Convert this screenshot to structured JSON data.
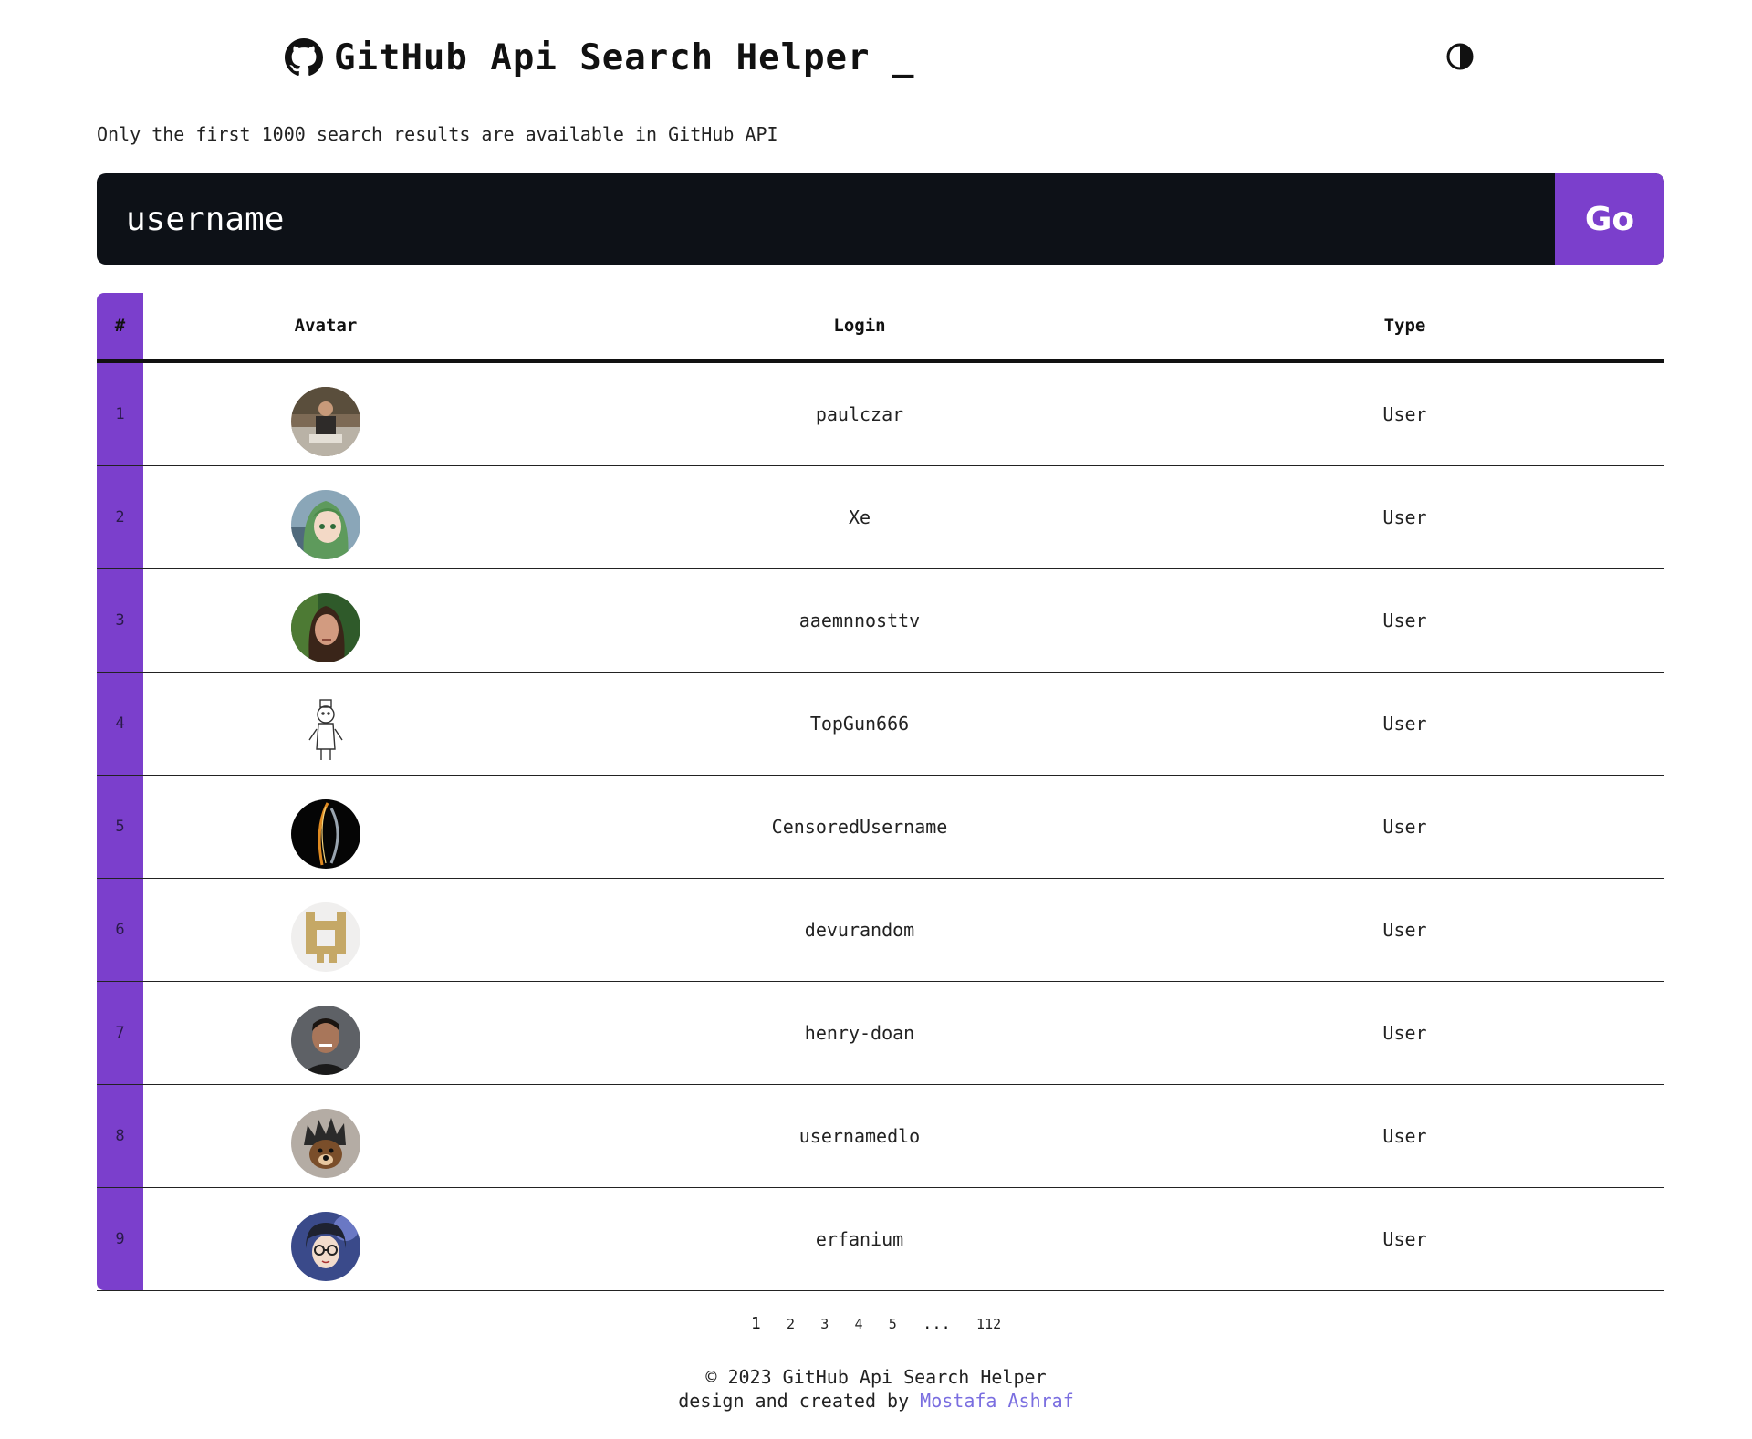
{
  "header": {
    "title": "GitHub Api Search Helper _",
    "logo_icon": "github-icon",
    "theme_toggle_icon": "contrast-icon"
  },
  "note": "Only the first 1000 search results are available in GitHub API",
  "search": {
    "value": "username",
    "button_label": "Go"
  },
  "colors": {
    "accent": "#7b3fcc",
    "search_bg": "#0d1117",
    "link": "#7a6ee0"
  },
  "table": {
    "headers": {
      "index": "#",
      "avatar": "Avatar",
      "login": "Login",
      "type": "Type"
    },
    "rows": [
      {
        "index": "1",
        "login": "paulczar",
        "type": "User",
        "avatar": "photo-man-seated"
      },
      {
        "index": "2",
        "login": "Xe",
        "type": "User",
        "avatar": "anime-green-hair"
      },
      {
        "index": "3",
        "login": "aaemnnosttv",
        "type": "User",
        "avatar": "photo-man-long-hair"
      },
      {
        "index": "4",
        "login": "TopGun666",
        "type": "User",
        "avatar": "sketch-figure"
      },
      {
        "index": "5",
        "login": "CensoredUsername",
        "type": "User",
        "avatar": "dark-fire-swirl"
      },
      {
        "index": "6",
        "login": "devurandom",
        "type": "User",
        "avatar": "identicon-gold"
      },
      {
        "index": "7",
        "login": "henry-doan",
        "type": "User",
        "avatar": "photo-man-smiling"
      },
      {
        "index": "8",
        "login": "usernamedlo",
        "type": "User",
        "avatar": "dog-spiky-hair"
      },
      {
        "index": "9",
        "login": "erfanium",
        "type": "User",
        "avatar": "anime-glasses"
      }
    ]
  },
  "pagination": {
    "current": "1",
    "pages": [
      "2",
      "3",
      "4",
      "5"
    ],
    "ellipsis": "...",
    "last": "112"
  },
  "footer": {
    "copyright": "© 2023 GitHub Api Search Helper",
    "credit_prefix": "design and created by",
    "author": "Mostafa Ashraf"
  }
}
